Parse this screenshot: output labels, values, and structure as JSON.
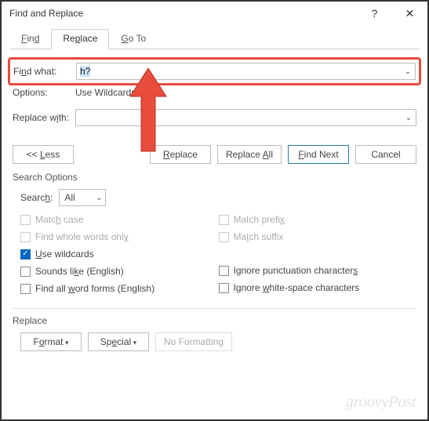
{
  "titlebar": {
    "title": "Find and Replace"
  },
  "tabs": {
    "find": "Find",
    "replace": "Replace",
    "goto": "Go To"
  },
  "find": {
    "label": "Find what:",
    "value": "h?",
    "options_label": "Options:",
    "options_value": "Use Wildcards"
  },
  "replace": {
    "label": "Replace with:",
    "value": ""
  },
  "buttons": {
    "less": "<< Less",
    "replace": "Replace",
    "replace_all": "Replace All",
    "find_next": "Find Next",
    "cancel": "Cancel"
  },
  "search_options": {
    "title": "Search Options",
    "search_label": "Search:",
    "search_value": "All",
    "match_case": "Match case",
    "whole_words": "Find whole words only",
    "use_wildcards": "Use wildcards",
    "sounds_like": "Sounds like (English)",
    "word_forms": "Find all word forms (English)",
    "match_prefix": "Match prefix",
    "match_suffix": "Match suffix",
    "ignore_punct": "Ignore punctuation characters",
    "ignore_space": "Ignore white-space characters"
  },
  "bottom": {
    "title": "Replace",
    "format": "Format",
    "special": "Special",
    "no_formatting": "No Formatting"
  },
  "watermark": "groovyPost",
  "annotation": {
    "color": "#E74C3C"
  }
}
